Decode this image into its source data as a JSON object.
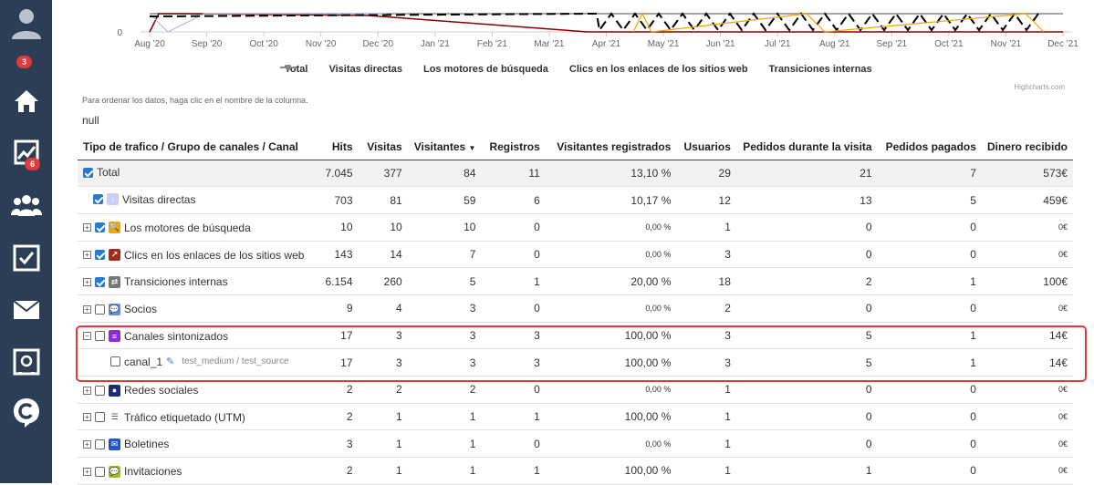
{
  "sidebar": {
    "badges": {
      "profile": "3",
      "stats": "6"
    },
    "icons": [
      "user-avatar-icon",
      "home-icon",
      "stats-chart-icon",
      "users-group-icon",
      "checklist-icon",
      "mail-icon",
      "safe-icon",
      "c-logo-icon"
    ]
  },
  "chart_data": {
    "type": "line",
    "x": [
      "Aug '20",
      "Sep '20",
      "Oct '20",
      "Nov '20",
      "Dec '20",
      "Jan '21",
      "Feb '21",
      "Mar '21",
      "Apr '21",
      "May '21",
      "Jun '21",
      "Jul '21",
      "Aug '21",
      "Sep '21",
      "Oct '21",
      "Nov '21",
      "Dec '21"
    ],
    "y_zero_label": "0",
    "series": [
      {
        "name": "Total",
        "color": "#000000"
      },
      {
        "name": "Visitas directas",
        "color": "#b9b9e8"
      },
      {
        "name": "Los motores de búsqueda",
        "color": "#f0a500"
      },
      {
        "name": "Clics en los enlaces de los sitios web",
        "color": "#8b0000"
      },
      {
        "name": "Transiciones internas",
        "color": "#888888"
      }
    ],
    "credits": "Highcharts.com"
  },
  "notes": {
    "sort_hint": "Para ordenar los datos, haga clic en el nombre de la columna.",
    "null_text": "null"
  },
  "table": {
    "headers": {
      "channel": "Tipo de trafico / Grupo de canales / Canal",
      "hits": "Hits",
      "visits": "Visitas",
      "visitors": "Visitantes",
      "registrations": "Registros",
      "reg_visitors": "Visitantes registrados",
      "users": "Usuarios",
      "orders_visit": "Pedidos durante la visita",
      "orders_paid": "Pedidos pagados",
      "money": "Dinero recibido"
    },
    "rows": [
      {
        "label": "Total",
        "hits": "7.045",
        "visits": "377",
        "visitors": "84",
        "registrations": "11",
        "reg_visitors": "13,10 %",
        "users": "29",
        "orders_visit": "21",
        "orders_paid": "7",
        "money": "573€"
      },
      {
        "label": "Visitas directas",
        "hits": "703",
        "visits": "81",
        "visitors": "59",
        "registrations": "6",
        "reg_visitors": "10,17 %",
        "users": "12",
        "orders_visit": "13",
        "orders_paid": "5",
        "money": "459€"
      },
      {
        "label": "Los motores de búsqueda",
        "hits": "10",
        "visits": "10",
        "visitors": "10",
        "registrations": "0",
        "reg_visitors": "0,00 %",
        "users": "1",
        "orders_visit": "0",
        "orders_paid": "0",
        "money": "0€"
      },
      {
        "label": "Clics en los enlaces de los sitios web",
        "hits": "143",
        "visits": "14",
        "visitors": "7",
        "registrations": "0",
        "reg_visitors": "0,00 %",
        "users": "3",
        "orders_visit": "0",
        "orders_paid": "0",
        "money": "0€"
      },
      {
        "label": "Transiciones internas",
        "hits": "6.154",
        "visits": "260",
        "visitors": "5",
        "registrations": "1",
        "reg_visitors": "20,00 %",
        "users": "18",
        "orders_visit": "2",
        "orders_paid": "1",
        "money": "100€"
      },
      {
        "label": "Socios",
        "hits": "9",
        "visits": "4",
        "visitors": "3",
        "registrations": "0",
        "reg_visitors": "0,00 %",
        "users": "2",
        "orders_visit": "0",
        "orders_paid": "0",
        "money": "0€"
      },
      {
        "label": "Canales sintonizados",
        "hits": "17",
        "visits": "3",
        "visitors": "3",
        "registrations": "3",
        "reg_visitors": "100,00 %",
        "users": "3",
        "orders_visit": "5",
        "orders_paid": "1",
        "money": "14€"
      },
      {
        "label": "canal_1",
        "sub": "test_medium / test_source",
        "hits": "17",
        "visits": "3",
        "visitors": "3",
        "registrations": "3",
        "reg_visitors": "100,00 %",
        "users": "3",
        "orders_visit": "5",
        "orders_paid": "1",
        "money": "14€"
      },
      {
        "label": "Redes sociales",
        "hits": "2",
        "visits": "2",
        "visitors": "2",
        "registrations": "0",
        "reg_visitors": "0,00 %",
        "users": "1",
        "orders_visit": "0",
        "orders_paid": "0",
        "money": "0€"
      },
      {
        "label": "Tráfico etiquetado (UTM)",
        "hits": "2",
        "visits": "1",
        "visitors": "1",
        "registrations": "1",
        "reg_visitors": "100,00 %",
        "users": "1",
        "orders_visit": "0",
        "orders_paid": "0",
        "money": "0€"
      },
      {
        "label": "Boletines",
        "hits": "3",
        "visits": "1",
        "visitors": "1",
        "registrations": "0",
        "reg_visitors": "0,00 %",
        "users": "1",
        "orders_visit": "0",
        "orders_paid": "0",
        "money": "0€"
      },
      {
        "label": "Invitaciones",
        "hits": "2",
        "visits": "1",
        "visitors": "1",
        "registrations": "1",
        "reg_visitors": "100,00 %",
        "users": "1",
        "orders_visit": "1",
        "orders_paid": "0",
        "money": "0€"
      }
    ]
  }
}
